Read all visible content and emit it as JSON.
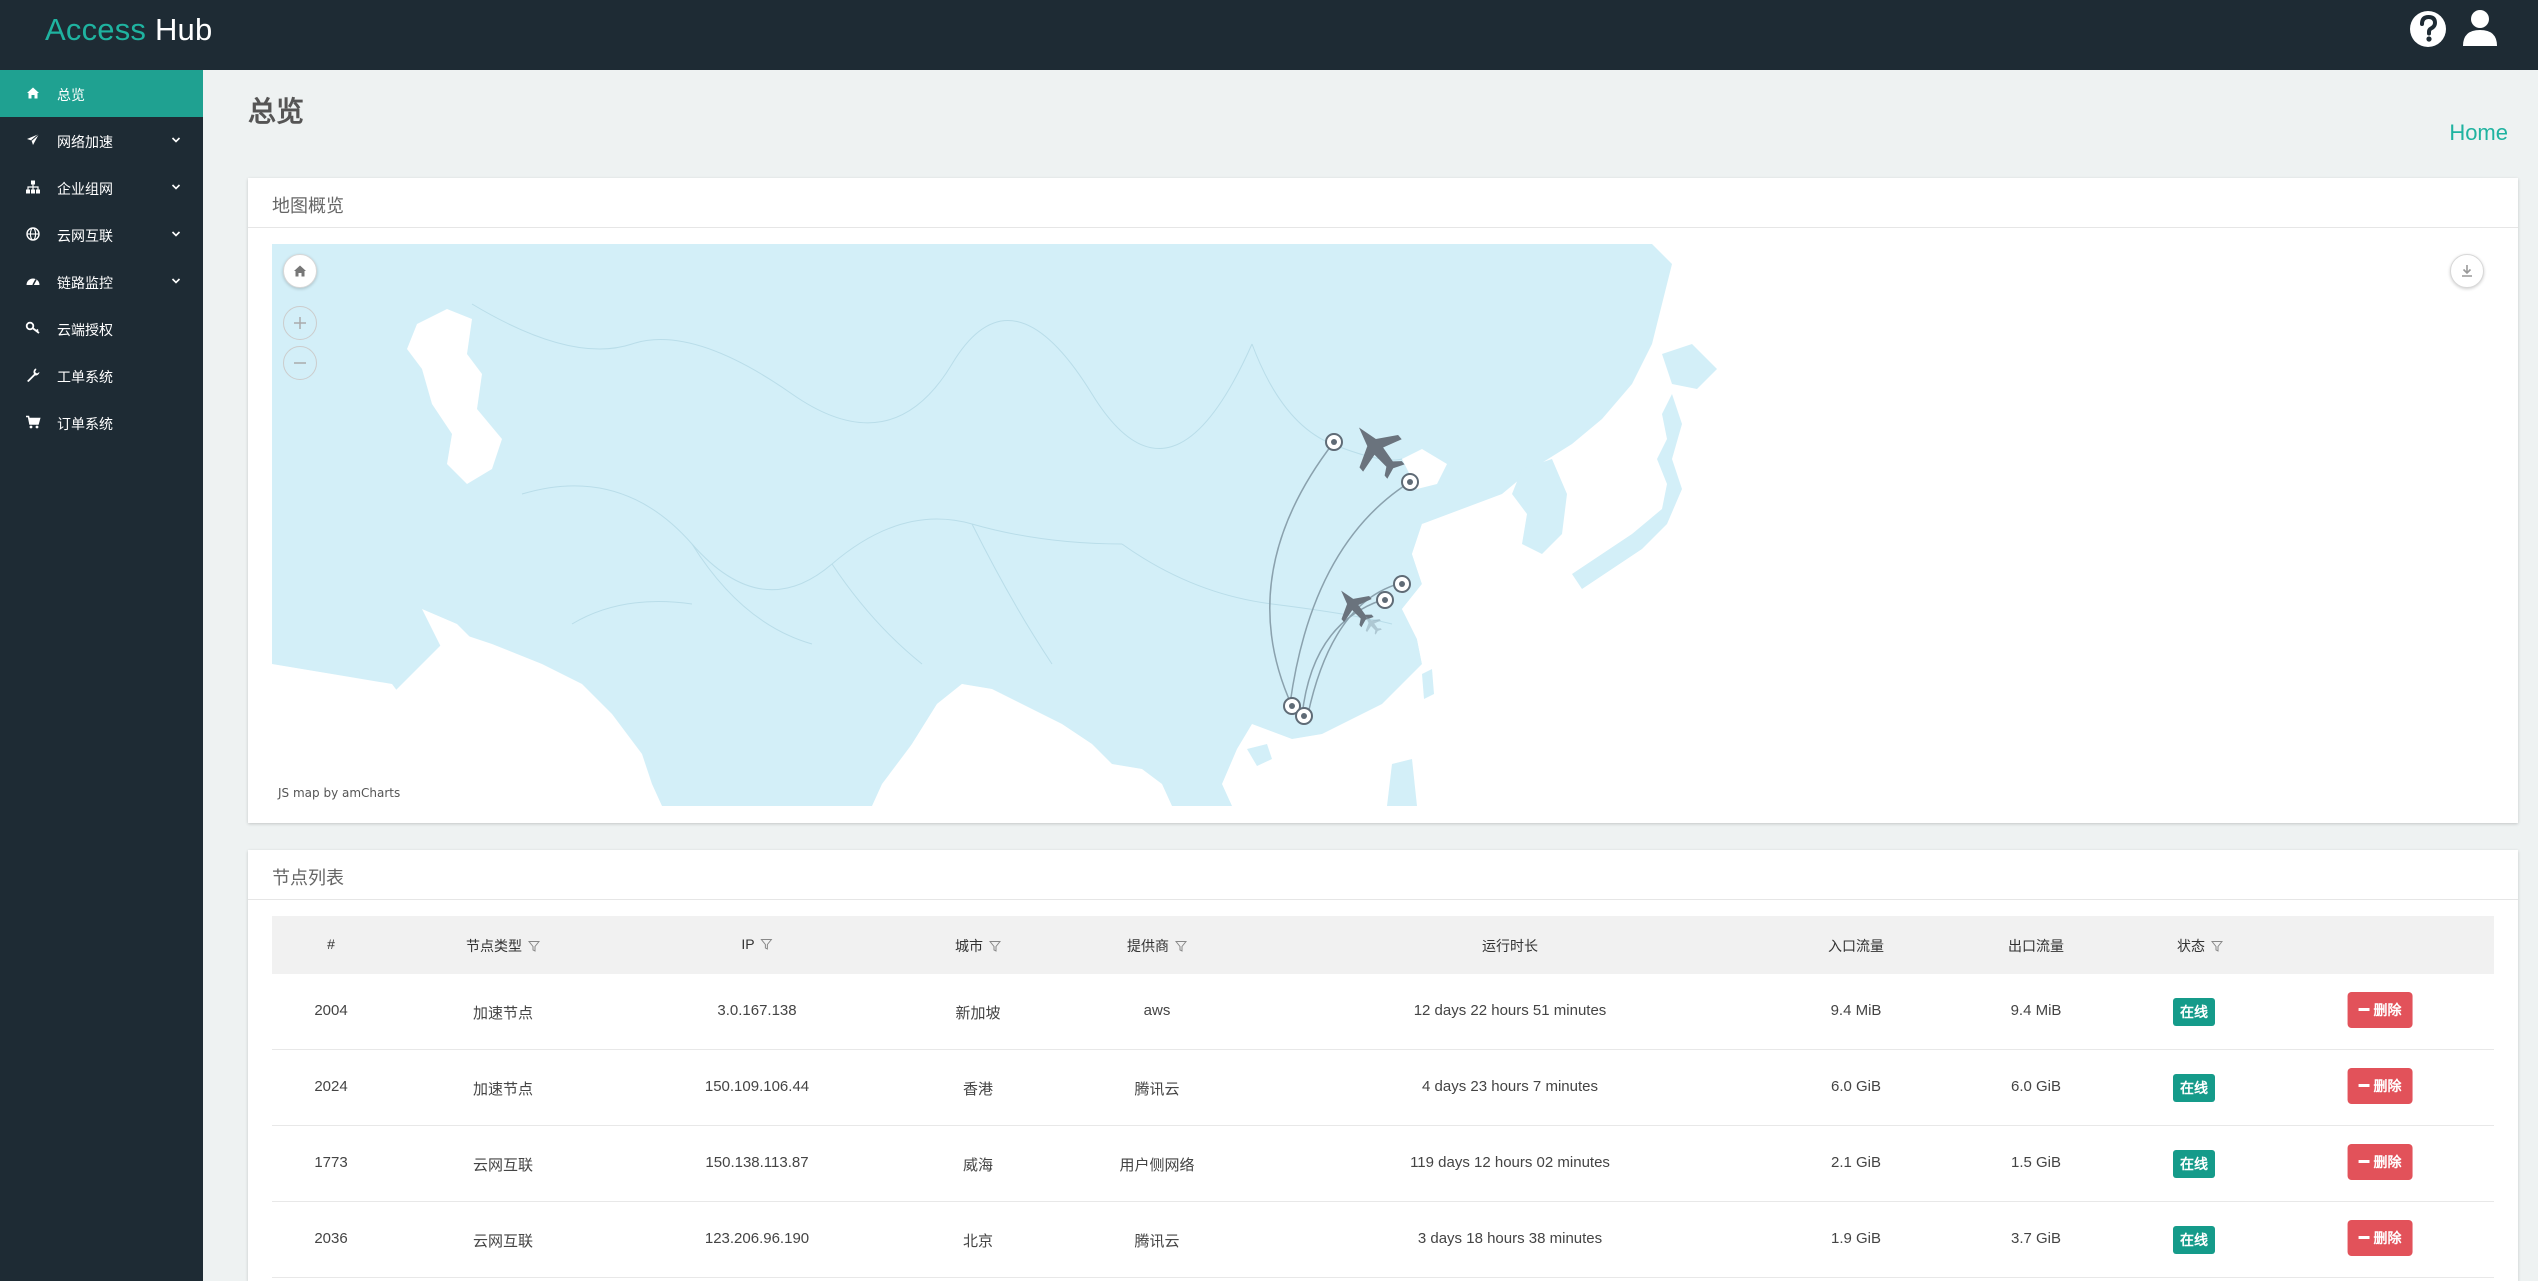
{
  "header": {
    "brand_part1": "Access",
    "brand_part2": "Hub"
  },
  "sidebar": {
    "items": [
      {
        "label": "总览",
        "icon": "home-icon",
        "active": true
      },
      {
        "label": "网络加速",
        "icon": "plane-icon",
        "expandable": true
      },
      {
        "label": "企业组网",
        "icon": "sitemap-icon",
        "expandable": true
      },
      {
        "label": "云网互联",
        "icon": "globe-icon",
        "expandable": true
      },
      {
        "label": "链路监控",
        "icon": "dashboard-icon",
        "expandable": true
      },
      {
        "label": "云端授权",
        "icon": "key-icon"
      },
      {
        "label": "工单系统",
        "icon": "wrench-icon"
      },
      {
        "label": "订单系统",
        "icon": "cart-icon"
      }
    ]
  },
  "page": {
    "title": "总览",
    "breadcrumb": "Home"
  },
  "map_card": {
    "title": "地图概览",
    "credit": "JS map by amCharts"
  },
  "table_card": {
    "title": "节点列表",
    "columns": [
      "#",
      "节点类型",
      "IP",
      "城市",
      "提供商",
      "运行时长",
      "入口流量",
      "出口流量",
      "状态"
    ],
    "rows": [
      {
        "id": "2004",
        "type": "加速节点",
        "ip": "3.0.167.138",
        "city": "新加坡",
        "provider": "aws",
        "uptime": "12 days 22 hours 51 minutes",
        "in": "9.4 MiB",
        "out": "9.4 MiB",
        "status": "在线",
        "action": "删除"
      },
      {
        "id": "2024",
        "type": "加速节点",
        "ip": "150.109.106.44",
        "city": "香港",
        "provider": "腾讯云",
        "uptime": "4 days 23 hours 7 minutes",
        "in": "6.0 GiB",
        "out": "6.0 GiB",
        "status": "在线",
        "action": "删除"
      },
      {
        "id": "1773",
        "type": "云网互联",
        "ip": "150.138.113.87",
        "city": "威海",
        "provider": "用户侧网络",
        "uptime": "119 days 12 hours 02 minutes",
        "in": "2.1 GiB",
        "out": "1.5 GiB",
        "status": "在线",
        "action": "删除"
      },
      {
        "id": "2036",
        "type": "云网互联",
        "ip": "123.206.96.190",
        "city": "北京",
        "provider": "腾讯云",
        "uptime": "3 days 18 hours 38 minutes",
        "in": "1.9 GiB",
        "out": "3.7 GiB",
        "status": "在线",
        "action": "删除"
      }
    ]
  },
  "colors": {
    "accent": "#1fa191",
    "header_bg": "#1e2b34",
    "online": "#159b8a",
    "danger": "#e2525a",
    "map_land": "#d3eff8"
  }
}
